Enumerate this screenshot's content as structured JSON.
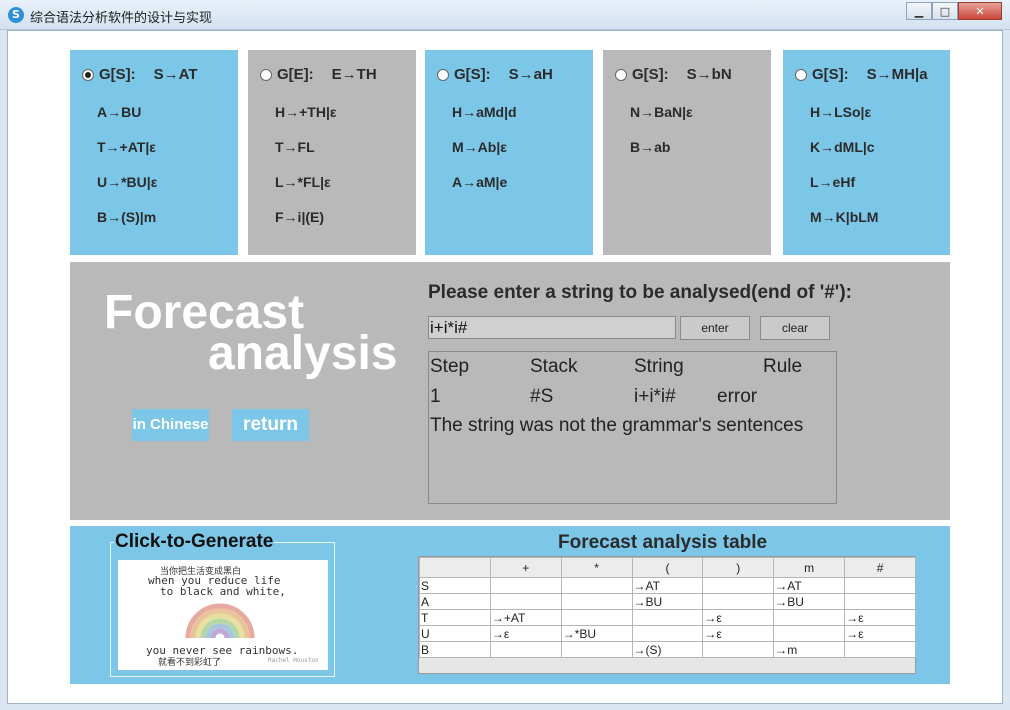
{
  "window": {
    "title": "综合语法分析软件的设计与实现",
    "icon_letter": "S",
    "buttons": [
      "▁",
      "□",
      "✕"
    ]
  },
  "grammars": [
    {
      "head_symbol": "G[S]:",
      "head_rule": "S→AT",
      "selected": true,
      "rules": [
        "A→BU",
        "T→+AT|ε",
        "U→*BU|ε",
        "B→(S)|m"
      ]
    },
    {
      "head_symbol": "G[E]:",
      "head_rule": "E→TH",
      "selected": false,
      "rules": [
        "H→+TH|ε",
        "T→FL",
        "L→*FL|ε",
        "F→i|(E)"
      ]
    },
    {
      "head_symbol": "G[S]:",
      "head_rule": "S→aH",
      "selected": false,
      "rules": [
        "H→aMd|d",
        "M→Ab|ε",
        "A→aM|e"
      ]
    },
    {
      "head_symbol": "G[S]:",
      "head_rule": "S→bN",
      "selected": false,
      "rules": [
        "N→BaN|ε",
        "B→ab"
      ]
    },
    {
      "head_symbol": "G[S]:",
      "head_rule": "S→MH|a",
      "selected": false,
      "rules": [
        "H→LSo|ε",
        "K→dML|c",
        "L→eHf",
        "M→K|bLM"
      ]
    }
  ],
  "forecast": {
    "title_line1": "Forecast",
    "title_line2": "analysis",
    "chinese_button": "in Chinese",
    "return_button": "return",
    "prompt": "Please enter a string to be analysed(end of '#'):",
    "input_value": "i+i*i#",
    "enter_button": "enter",
    "clear_button": "clear",
    "output": {
      "headers": [
        "Step",
        "Stack",
        "String",
        "Rule"
      ],
      "row": [
        "1",
        "#S",
        "i+i*i#",
        "error"
      ],
      "message": "The string was not the grammar's sentences"
    }
  },
  "generate": {
    "title": "Click-to-Generate",
    "image_text": {
      "line1": "当你把生活变成黑白",
      "line2": "when you reduce life",
      "line3": "to black and white,",
      "line4": "you never see rainbows.",
      "line5": "就看不到彩虹了",
      "signature": "Rachel Houston"
    }
  },
  "table": {
    "title": "Forecast analysis table",
    "columns": [
      "",
      "+",
      "*",
      "(",
      ")",
      "m",
      "#"
    ],
    "rows": [
      [
        "S",
        "",
        "",
        "→AT",
        "",
        "→AT",
        ""
      ],
      [
        "A",
        "",
        "",
        "→BU",
        "",
        "→BU",
        ""
      ],
      [
        "T",
        "→+AT",
        "",
        "",
        "→ε",
        "",
        "→ε"
      ],
      [
        "U",
        "→ε",
        "→*BU",
        "",
        "→ε",
        "",
        "→ε"
      ],
      [
        "B",
        "",
        "",
        "→(S)",
        "",
        "→m",
        ""
      ]
    ]
  },
  "colors": {
    "panel_blue": "#7cc7e8",
    "panel_gray": "#b8b9b8",
    "title_white": "#ffffff"
  }
}
